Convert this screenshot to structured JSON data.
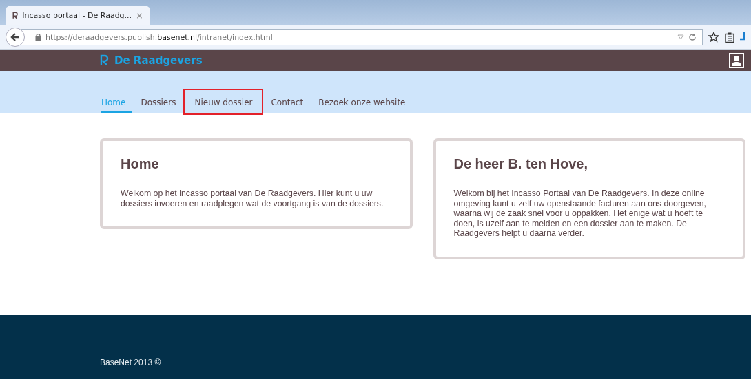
{
  "browser": {
    "tab": {
      "title": "Incasso portaal - De Raadg...",
      "close": "×"
    },
    "url": "https://deraadgevers.publish.**basenet.nl**/intranet/index.html"
  },
  "header": {
    "brand": "De Raadgevers"
  },
  "nav": [
    {
      "label": "Home",
      "selected": true,
      "highlighted": false
    },
    {
      "label": "Dossiers",
      "selected": false,
      "highlighted": false
    },
    {
      "label": "Nieuw dossier",
      "selected": false,
      "highlighted": true
    },
    {
      "label": "Contact",
      "selected": false,
      "highlighted": false
    },
    {
      "label": "Bezoek onze website",
      "selected": false,
      "highlighted": false
    }
  ],
  "cards": [
    {
      "title": "Home",
      "text": "Welkom op het incasso portaal van De Raadgevers. Hier kunt u uw dossiers invoeren en raadplegen wat de voortgang is van de dossiers."
    },
    {
      "title": "De heer B. ten Hove,",
      "text": "Welkom bij het Incasso Portaal van De Raadgevers. In deze online omgeving kunt u zelf uw openstaande facturen aan ons doorgeven, waarna wij de zaak snel voor u oppakken. Het enige wat u hoeft te doen, is uzelf aan te melden en een dossier aan te maken. De Raadgevers helpt u daarna verder."
    }
  ],
  "footer": {
    "text": "BaseNet 2013 ©"
  }
}
